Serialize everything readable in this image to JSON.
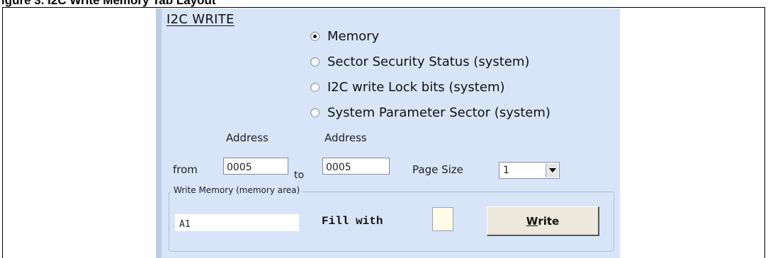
{
  "figure_caption": "igure 3.  I2C Write Memory Tab Layout",
  "panel": {
    "title": "I2C WRITE",
    "radio_options": [
      {
        "label": "Memory",
        "checked": true
      },
      {
        "label": "Sector Security Status (system)",
        "checked": false
      },
      {
        "label": "I2C write Lock bits (system)",
        "checked": false
      },
      {
        "label": "System Parameter Sector (system)",
        "checked": false
      }
    ],
    "address_label_1": "Address",
    "address_label_2": "Address",
    "from_label": "from",
    "from_value": "0005",
    "to_label": "to",
    "to_value": "0005",
    "page_size_label": "Page Size",
    "page_size_value": "1"
  },
  "write_group": {
    "title": "Write Memory (memory area)",
    "data_value": "A1",
    "fill_label": "Fill with",
    "fill_value": "",
    "write_button_mnemonic": "W",
    "write_button_rest": "rite"
  },
  "colors": {
    "panel_bg": "#d8e4f8",
    "fill_box": "#fffbe6",
    "button_bg": "#ece9dc"
  }
}
